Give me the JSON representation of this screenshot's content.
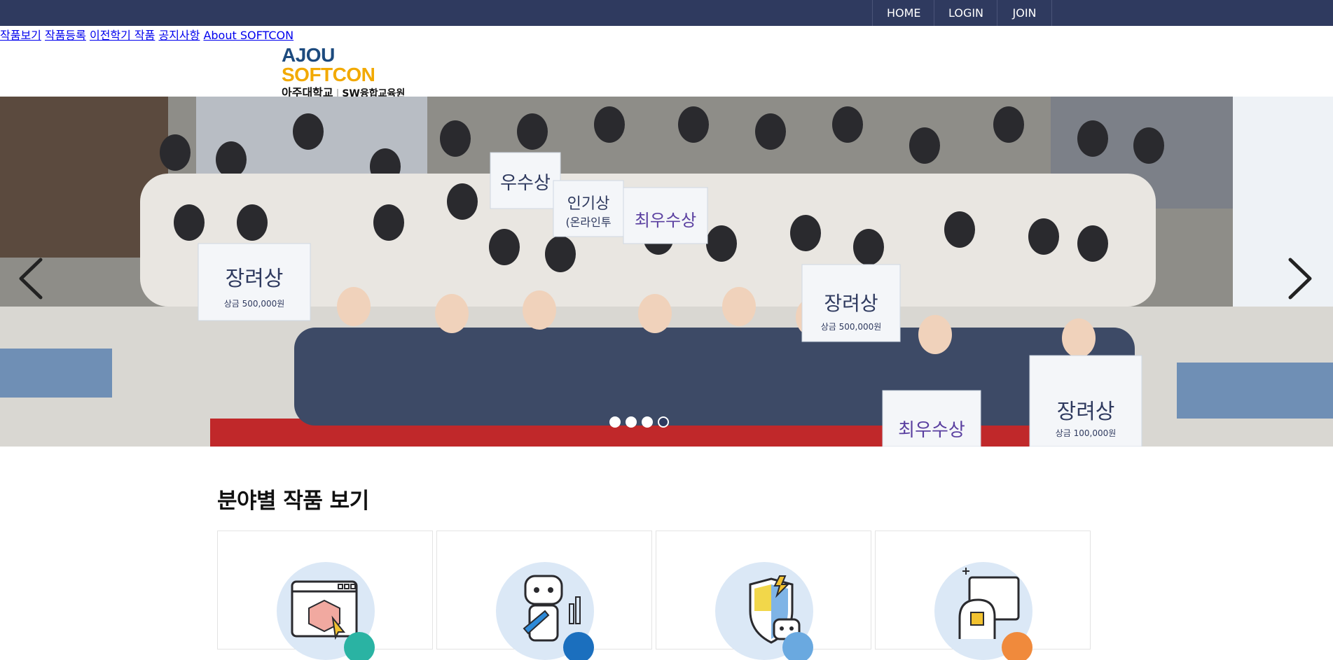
{
  "topbar": {
    "links": [
      "HOME",
      "LOGIN",
      "JOIN"
    ]
  },
  "logo": {
    "ajou": "AJOU",
    "softcon": "SOFTCON",
    "university": "아주대학교",
    "institute": "SW융합교육원"
  },
  "nav": {
    "items": [
      "작품보기",
      "작품등록",
      "이전학기 작품",
      "공지사항",
      "About SOFTCON"
    ]
  },
  "hero": {
    "signs": [
      {
        "title": "장려상",
        "prize": "상금 500,000원"
      },
      {
        "title": "우수상"
      },
      {
        "title": "인기상"
      },
      {
        "title": "(온라인투"
      },
      {
        "title": "최우수상"
      },
      {
        "title": "장려상",
        "prize": "상금 500,000원"
      },
      {
        "title": "장려상",
        "prize": "상금 100,000원"
      },
      {
        "title": "최우수상"
      }
    ],
    "slides_total": 4,
    "active_slide": 4
  },
  "section": {
    "title": "분야별 작품 보기"
  },
  "categories": [
    {
      "icon": "web-cube-icon"
    },
    {
      "icon": "robot-wrench-icon"
    },
    {
      "icon": "shield-robot-icon"
    },
    {
      "icon": "ai-brain-computer-icon"
    }
  ],
  "colors": {
    "topbar": "#2f3a5f",
    "ajou_blue": "#1c4a7e",
    "softcon_yellow": "#f2a900",
    "icon_circle": "#dbe8f6"
  }
}
